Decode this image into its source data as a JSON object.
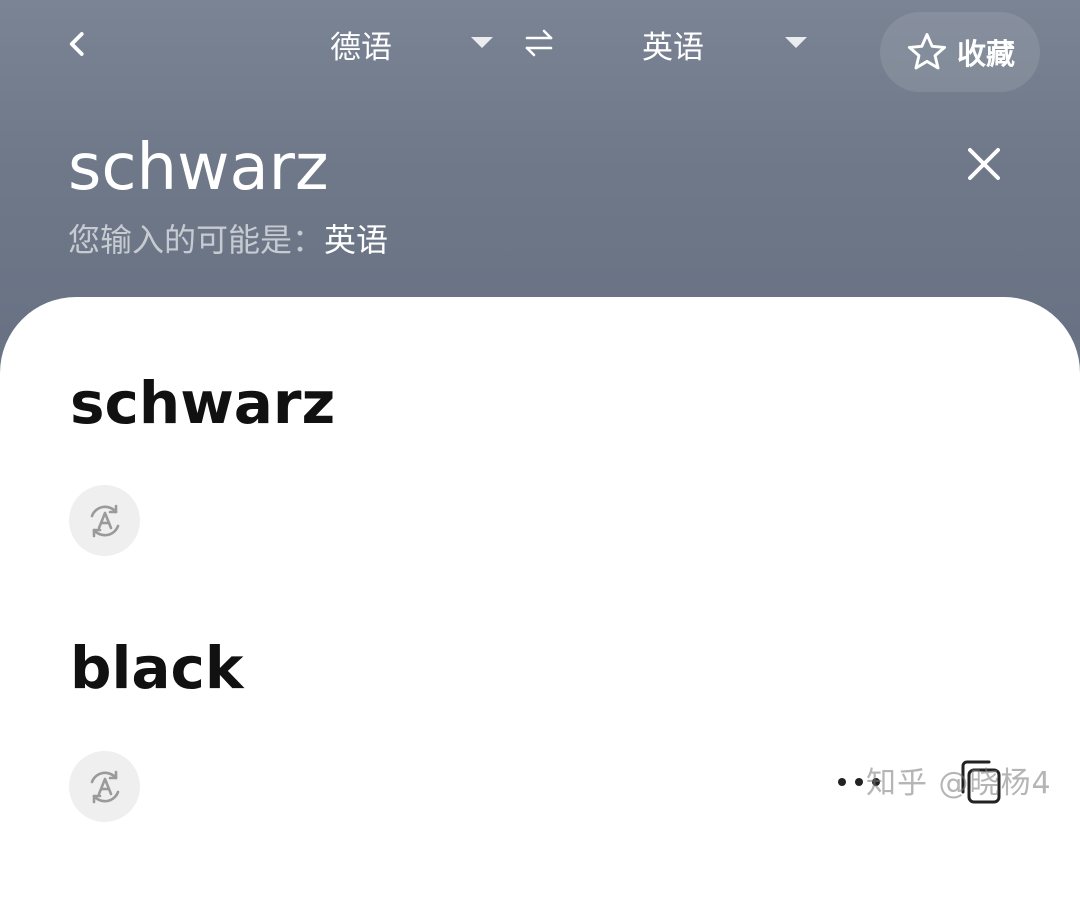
{
  "toolbar": {
    "source_lang": "德语",
    "target_lang": "英语",
    "favorite_label": "收藏",
    "icons": [
      "back-icon",
      "caret-down-icon",
      "swap-icon",
      "star-icon"
    ]
  },
  "input": {
    "query": "schwarz",
    "detect_prefix": "您输入的可能是：",
    "detect_lang": "英语",
    "clear_icon": "close-icon"
  },
  "result": {
    "source_term": "schwarz",
    "translation": "black",
    "speak_icon": "pronounce-icon",
    "more_icon": "more-dots-icon",
    "copy_icon": "copy-icon"
  },
  "watermark": "知乎 @晓杨4",
  "colors": {
    "header_bg": "#6f7989",
    "card_bg": "#ffffff",
    "text_primary": "#111111",
    "icon_bg": "#efefef"
  }
}
